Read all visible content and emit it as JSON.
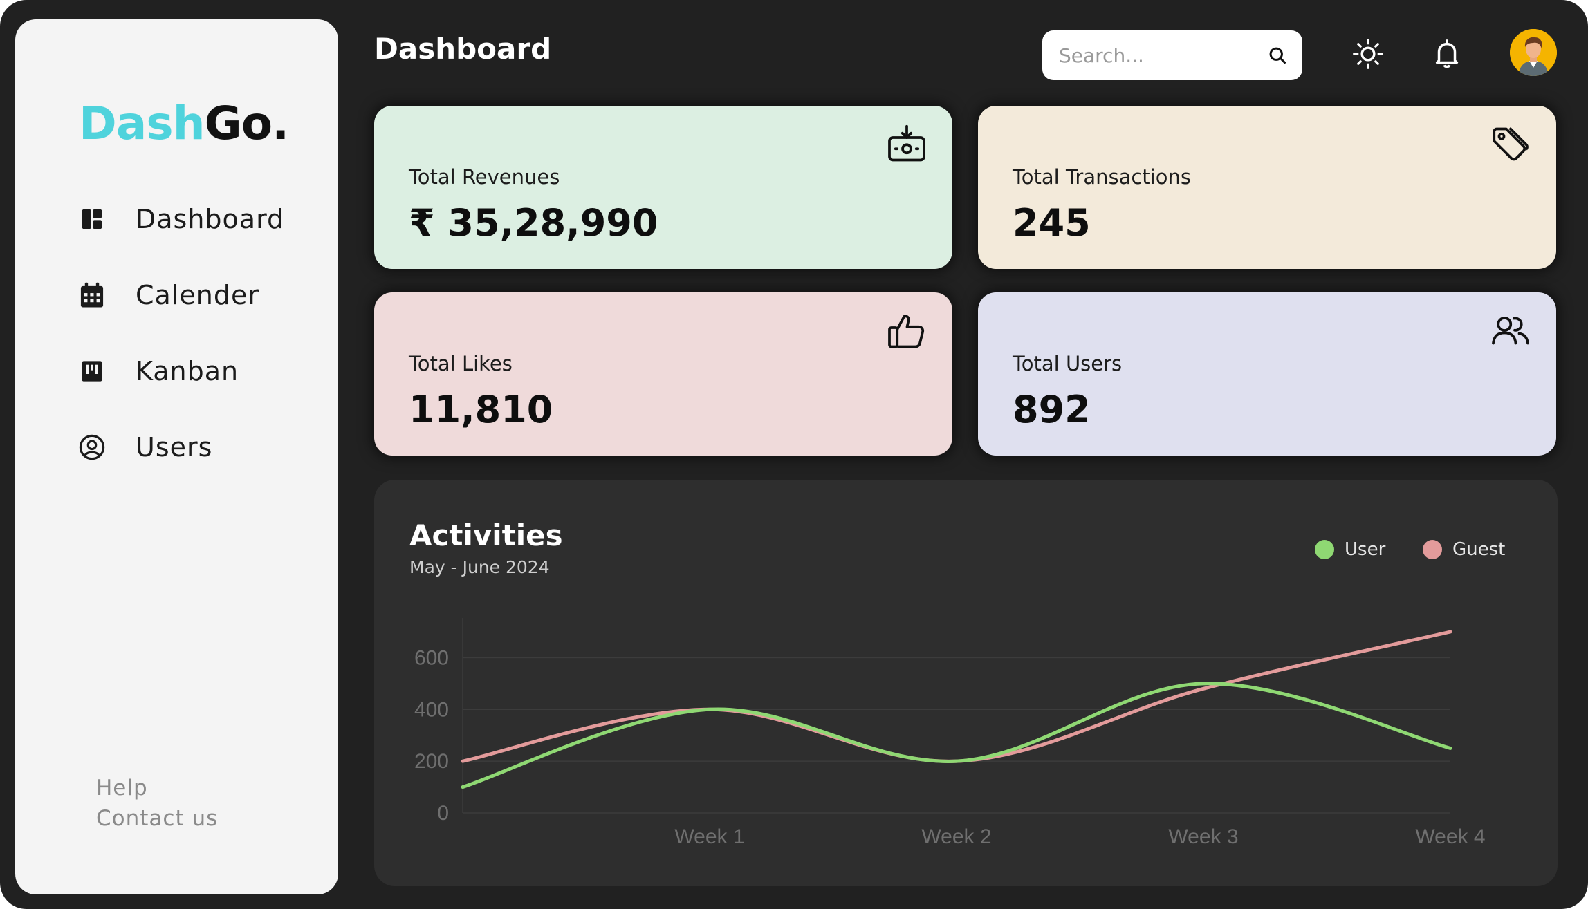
{
  "logo": {
    "part1": "Dash",
    "part2": "Go."
  },
  "sidebar": {
    "items": [
      {
        "label": "Dashboard",
        "icon": "dashboard-icon"
      },
      {
        "label": "Calender",
        "icon": "calendar-icon"
      },
      {
        "label": "Kanban",
        "icon": "kanban-icon"
      },
      {
        "label": "Users",
        "icon": "user-circle-icon"
      }
    ],
    "help": "Help",
    "contact": "Contact us"
  },
  "header": {
    "title": "Dashboard",
    "search_placeholder": "Search...",
    "icons": [
      "search-icon",
      "sun-icon",
      "bell-icon",
      "avatar"
    ]
  },
  "cards": [
    {
      "label": "Total Revenues",
      "value": "₹ 35,28,990",
      "color": "#dcefe2",
      "icon": "money-download-icon"
    },
    {
      "label": "Total Transactions",
      "value": "245",
      "color": "#f3eada",
      "icon": "tag-icon"
    },
    {
      "label": "Total Likes",
      "value": "11,810",
      "color": "#efdada",
      "icon": "thumbs-up-icon"
    },
    {
      "label": "Total Users",
      "value": "892",
      "color": "#dfe0ef",
      "icon": "users-icon"
    }
  ],
  "activities": {
    "title": "Activities",
    "subtitle": "May - June 2024"
  },
  "chart_data": {
    "type": "line",
    "categories": [
      "",
      "Week 1",
      "Week 2",
      "Week 3",
      "Week 4"
    ],
    "series": [
      {
        "name": "User",
        "color": "#8fd873",
        "values": [
          100,
          400,
          200,
          500,
          250
        ]
      },
      {
        "name": "Guest",
        "color": "#e39b9b",
        "values": [
          200,
          400,
          200,
          480,
          700
        ]
      }
    ],
    "yticks": [
      0,
      200,
      400,
      600
    ],
    "ylim": [
      0,
      700
    ],
    "smooth": true,
    "grid": true,
    "legend": "top-right"
  }
}
